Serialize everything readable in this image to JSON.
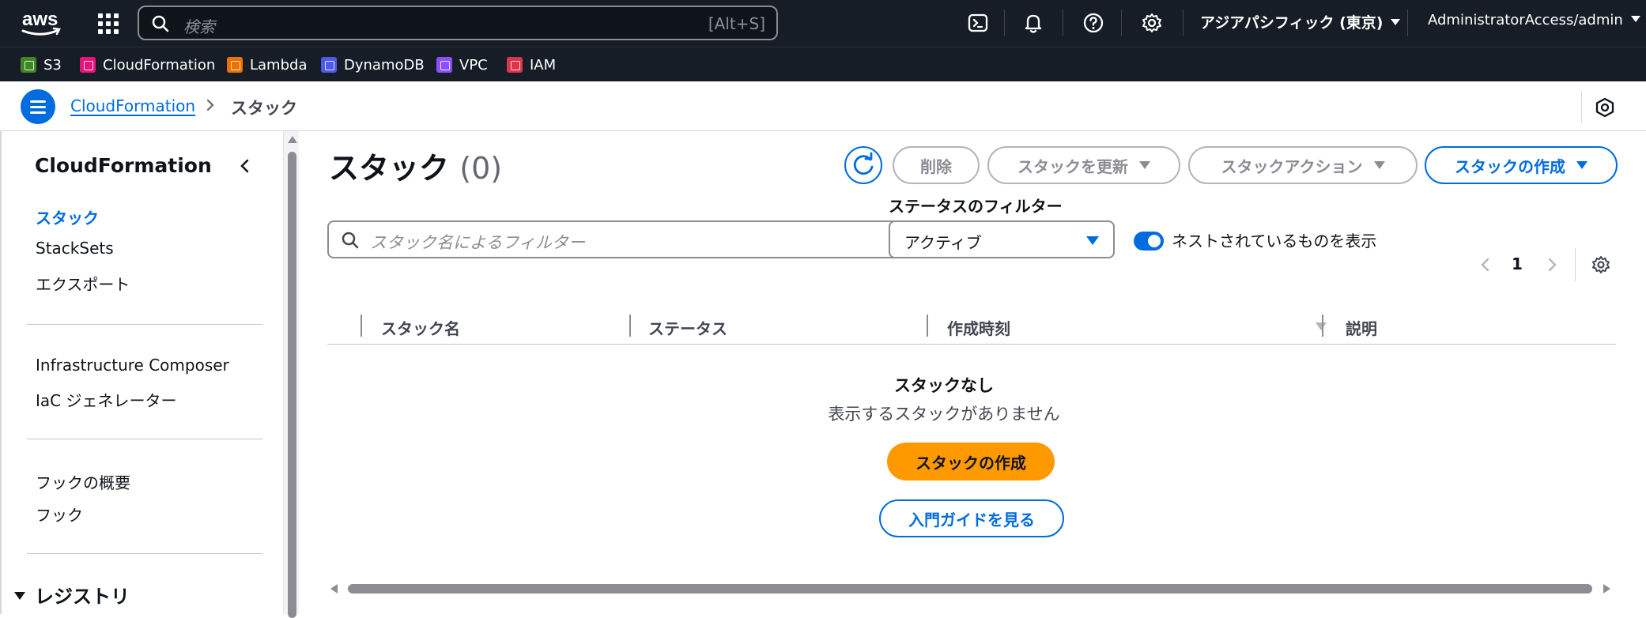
{
  "colors": {
    "topbar_bg": "#161d26",
    "accent_blue": "#006ce0",
    "primary_orange": "#ff9900",
    "disabled_gray": "#8c8c94"
  },
  "topnav": {
    "logo_icon": "aws-logo",
    "services_icon": "grid-icon",
    "search_placeholder": "検索",
    "search_shortcut": "[Alt+S]",
    "icons": [
      "cloudshell-icon",
      "bell-icon",
      "help-icon",
      "gear-icon"
    ],
    "region": "アジアパシフィック (東京)",
    "account": "AdministratorAccess/admin"
  },
  "favorites": [
    {
      "label": "S3",
      "color": "#3f8624",
      "icon": "s3-icon"
    },
    {
      "label": "CloudFormation",
      "color": "#e7157b",
      "icon": "cloudformation-icon"
    },
    {
      "label": "Lambda",
      "color": "#ed7100",
      "icon": "lambda-icon"
    },
    {
      "label": "DynamoDB",
      "color": "#4d5be8",
      "icon": "dynamodb-icon"
    },
    {
      "label": "VPC",
      "color": "#8c4fff",
      "icon": "vpc-icon"
    },
    {
      "label": "IAM",
      "color": "#dd344c",
      "icon": "iam-icon"
    }
  ],
  "breadcrumb": {
    "root": "CloudFormation",
    "current": "スタック"
  },
  "sidebar": {
    "title": "CloudFormation",
    "items": [
      {
        "label": "スタック",
        "active": true
      },
      {
        "label": "StackSets"
      },
      {
        "label": "エクスポート"
      },
      {
        "label": "Infrastructure Composer"
      },
      {
        "label": "IaC ジェネレーター"
      },
      {
        "label": "フックの概要"
      },
      {
        "label": "フック"
      }
    ],
    "section": "レジストリ"
  },
  "main": {
    "title": "スタック",
    "count": "(0)",
    "buttons": {
      "delete": "削除",
      "update": "スタックを更新",
      "actions": "スタックアクション",
      "create": "スタックの作成"
    },
    "filter_placeholder": "スタック名によるフィルター",
    "status_filter_label": "ステータスのフィルター",
    "status_filter_value": "アクティブ",
    "nested_toggle_label": "ネストされているものを表示",
    "nested_toggle_on": true,
    "page": "1",
    "columns": [
      "スタック名",
      "ステータス",
      "作成時刻",
      "説明"
    ],
    "empty_title": "スタックなし",
    "empty_message": "表示するスタックがありません",
    "empty_create_button": "スタックの作成",
    "empty_guide_button": "入門ガイドを見る"
  }
}
